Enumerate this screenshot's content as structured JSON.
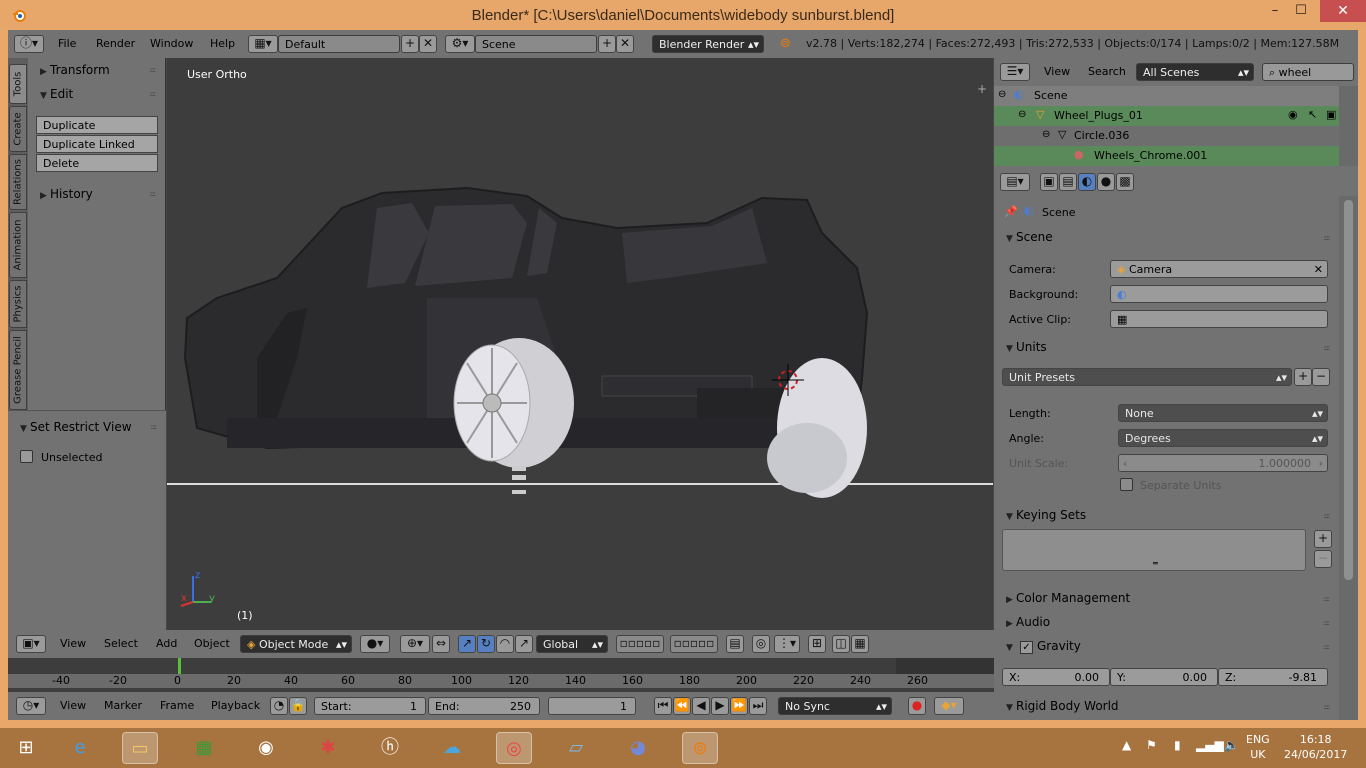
{
  "window": {
    "title": "Blender* [C:\\Users\\daniel\\Documents\\widebody sunburst.blend]",
    "minimize": "–",
    "maximize": "☐",
    "close": "✕"
  },
  "top_header": {
    "menus": [
      "File",
      "Render",
      "Window",
      "Help"
    ],
    "layout": "Default",
    "scene": "Scene",
    "engine": "Blender Render",
    "stats": "v2.78 | Verts:182,274 | Faces:272,493 | Tris:272,533 | Objects:0/174 | Lamps:0/2 | Mem:127.58M"
  },
  "tool_tabs": [
    "Tools",
    "Create",
    "Relations",
    "Animation",
    "Physics",
    "Grease Pencil"
  ],
  "tool_shelf": {
    "transform": "Transform",
    "edit": "Edit",
    "buttons": [
      "Duplicate",
      "Duplicate Linked",
      "Delete"
    ],
    "history": "History",
    "restrict": "Set Restrict View",
    "unselected": "Unselected"
  },
  "viewport": {
    "label": "User Ortho",
    "frame": "(1)",
    "axis_x": "x",
    "axis_y": "y",
    "axis_z": "z"
  },
  "view3d_header": {
    "menus": [
      "View",
      "Select",
      "Add",
      "Object"
    ],
    "mode": "Object Mode",
    "orientation": "Global"
  },
  "timeline": {
    "ticks": [
      "-40",
      "-20",
      "0",
      "20",
      "40",
      "60",
      "80",
      "100",
      "120",
      "140",
      "160",
      "180",
      "200",
      "220",
      "240",
      "260"
    ],
    "menus": [
      "View",
      "Marker",
      "Frame",
      "Playback"
    ],
    "start_label": "Start:",
    "start": "1",
    "end_label": "End:",
    "end": "250",
    "current": "1",
    "sync": "No Sync"
  },
  "outliner": {
    "view": "View",
    "search": "Search",
    "display": "All Scenes",
    "filter": "wheel",
    "rows": [
      "Scene",
      "Wheel_Plugs_01",
      "Circle.036",
      "Wheels_Chrome.001"
    ]
  },
  "properties": {
    "context": "Scene",
    "scene_section": "Scene",
    "camera_label": "Camera:",
    "camera": "Camera",
    "background_label": "Background:",
    "clip_label": "Active Clip:",
    "units_section": "Units",
    "unit_presets": "Unit Presets",
    "length_label": "Length:",
    "length": "None",
    "angle_label": "Angle:",
    "angle": "Degrees",
    "unit_scale_label": "Unit Scale:",
    "unit_scale": "1.000000",
    "separate_units": "Separate Units",
    "keying_sets": "Keying Sets",
    "color_management": "Color Management",
    "audio": "Audio",
    "gravity": "Gravity",
    "gx_label": "X:",
    "gx": "0.00",
    "gy_label": "Y:",
    "gy": "0.00",
    "gz_label": "Z:",
    "gz": "-9.81",
    "rigid_body": "Rigid Body World"
  },
  "taskbar": {
    "lang1": "ENG",
    "lang2": "UK",
    "time": "16:18",
    "date": "24/06/2017"
  }
}
